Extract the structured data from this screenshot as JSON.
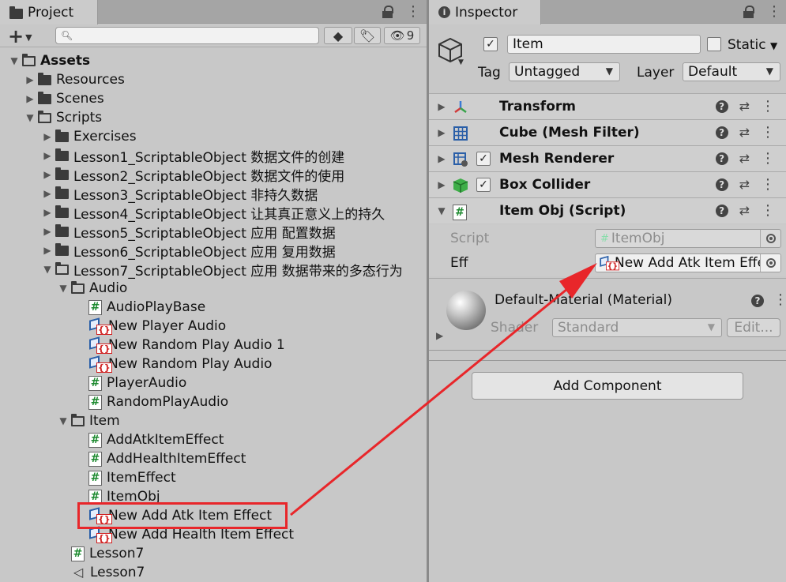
{
  "project": {
    "tab_label": "Project",
    "search_placeholder": "",
    "visible_count": "9",
    "tree": [
      {
        "label": "Assets",
        "depth": 0,
        "type": "folder-open",
        "arrow": "down",
        "bold": true
      },
      {
        "label": "Resources",
        "depth": 1,
        "type": "folder",
        "arrow": "right"
      },
      {
        "label": "Scenes",
        "depth": 1,
        "type": "folder",
        "arrow": "right"
      },
      {
        "label": "Scripts",
        "depth": 1,
        "type": "folder-open",
        "arrow": "down"
      },
      {
        "label": "Exercises",
        "depth": 2,
        "type": "folder",
        "arrow": "right"
      },
      {
        "label": "Lesson1_ScriptableObject 数据文件的创建",
        "depth": 2,
        "type": "folder",
        "arrow": "right"
      },
      {
        "label": "Lesson2_ScriptableObject 数据文件的使用",
        "depth": 2,
        "type": "folder",
        "arrow": "right"
      },
      {
        "label": "Lesson3_ScriptableObject 非持久数据",
        "depth": 2,
        "type": "folder",
        "arrow": "right"
      },
      {
        "label": "Lesson4_ScriptableObject 让其真正意义上的持久",
        "depth": 2,
        "type": "folder",
        "arrow": "right"
      },
      {
        "label": "Lesson5_ScriptableObject 应用 配置数据",
        "depth": 2,
        "type": "folder",
        "arrow": "right"
      },
      {
        "label": "Lesson6_ScriptableObject 应用 复用数据",
        "depth": 2,
        "type": "folder",
        "arrow": "right"
      },
      {
        "label": "Lesson7_ScriptableObject 应用 数据带来的多态行为",
        "depth": 2,
        "type": "folder-open",
        "arrow": "down"
      },
      {
        "label": "Audio",
        "depth": 3,
        "type": "folder-open",
        "arrow": "down"
      },
      {
        "label": "AudioPlayBase",
        "depth": 4,
        "type": "script",
        "arrow": ""
      },
      {
        "label": "New Player Audio",
        "depth": 4,
        "type": "scriptable-object",
        "arrow": ""
      },
      {
        "label": "New Random Play Audio 1",
        "depth": 4,
        "type": "scriptable-object",
        "arrow": ""
      },
      {
        "label": "New Random Play Audio",
        "depth": 4,
        "type": "scriptable-object",
        "arrow": ""
      },
      {
        "label": "PlayerAudio",
        "depth": 4,
        "type": "script",
        "arrow": ""
      },
      {
        "label": "RandomPlayAudio",
        "depth": 4,
        "type": "script",
        "arrow": ""
      },
      {
        "label": "Item",
        "depth": 3,
        "type": "folder-open",
        "arrow": "down"
      },
      {
        "label": "AddAtkItemEffect",
        "depth": 4,
        "type": "script",
        "arrow": ""
      },
      {
        "label": "AddHealthItemEffect",
        "depth": 4,
        "type": "script",
        "arrow": ""
      },
      {
        "label": "ItemEffect",
        "depth": 4,
        "type": "script",
        "arrow": ""
      },
      {
        "label": "ItemObj",
        "depth": 4,
        "type": "script",
        "arrow": ""
      },
      {
        "label": "New Add Atk Item Effect",
        "depth": 4,
        "type": "scriptable-object",
        "arrow": "",
        "highlighted": true
      },
      {
        "label": "New Add Health Item Effect",
        "depth": 4,
        "type": "scriptable-object",
        "arrow": ""
      },
      {
        "label": "Lesson7",
        "depth": 3,
        "type": "script",
        "arrow": ""
      },
      {
        "label": "Lesson7",
        "depth": 3,
        "type": "unity-scene",
        "arrow": ""
      }
    ]
  },
  "inspector": {
    "tab_label": "Inspector",
    "object_name": "Item",
    "static_label": "Static",
    "tag_label": "Tag",
    "tag_value": "Untagged",
    "layer_label": "Layer",
    "layer_value": "Default",
    "components": [
      {
        "title": "Transform",
        "icon": "transform-icon",
        "checkbox": false,
        "expanded": false
      },
      {
        "title": "Cube (Mesh Filter)",
        "icon": "mesh-filter-icon",
        "checkbox": false,
        "expanded": false
      },
      {
        "title": "Mesh Renderer",
        "icon": "mesh-renderer-icon",
        "checkbox": true,
        "expanded": false
      },
      {
        "title": "Box Collider",
        "icon": "box-collider-icon",
        "checkbox": true,
        "expanded": false
      },
      {
        "title": "Item Obj (Script)",
        "icon": "script-icon",
        "checkbox": false,
        "expanded": true
      }
    ],
    "script_field_label": "Script",
    "script_field_value": "ItemObj",
    "eff_field_label": "Eff",
    "eff_field_value": "New Add Atk Item Effe",
    "material_title": "Default-Material (Material)",
    "shader_label": "Shader",
    "shader_value": "Standard",
    "edit_button": "Edit...",
    "add_component_button": "Add Component"
  },
  "colors": {
    "annotation_red": "#e8262a",
    "panel_bg": "#c8c8c8",
    "script_green": "#1d8a2f"
  }
}
